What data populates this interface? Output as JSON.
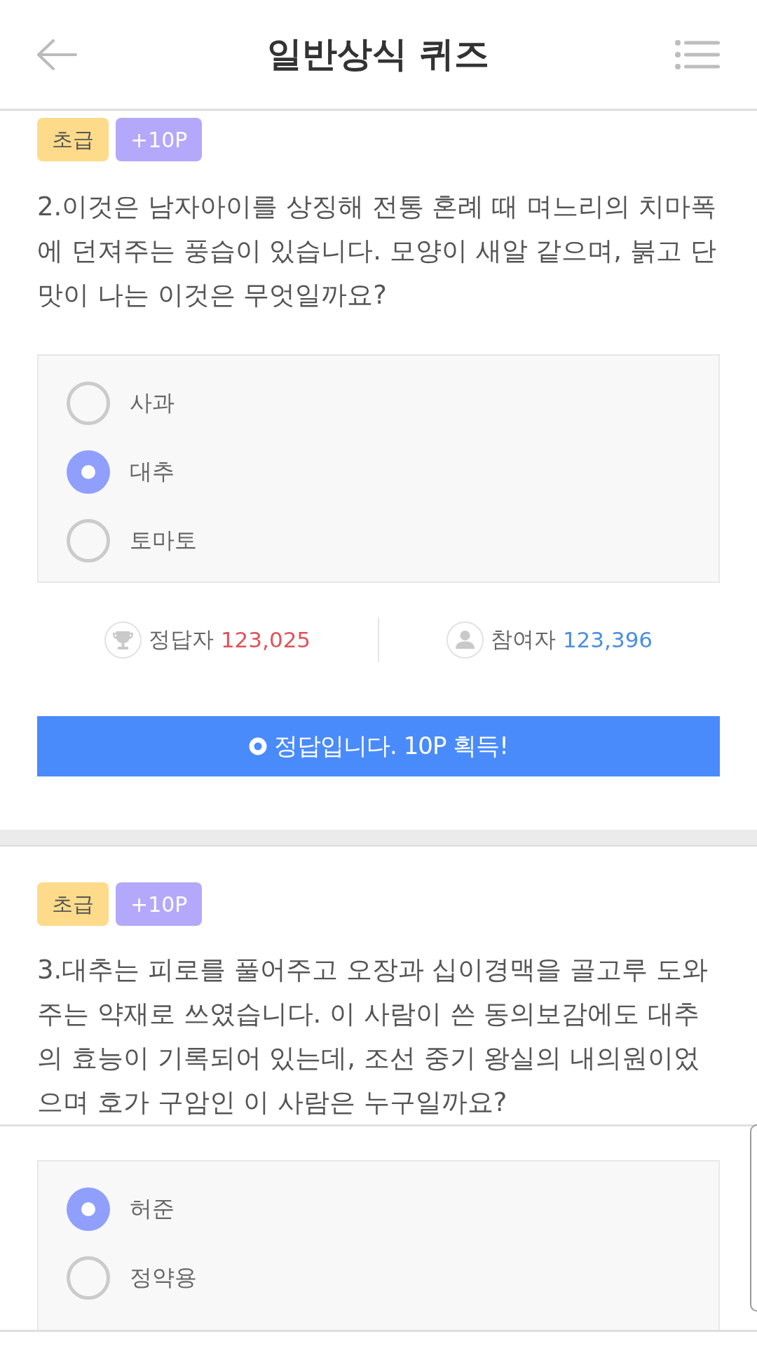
{
  "header": {
    "title": "일반상식 퀴즈"
  },
  "quizzes": [
    {
      "level": "초급",
      "points": "+10P",
      "question": "2.이것은 남자아이를 상징해 전통 혼례 때 며느리의 치마폭에 던져주는 풍습이 있습니다. 모양이 새알 같으며, 붉고 단맛이 나는 이것은 무엇일까요?",
      "options": [
        {
          "label": "사과",
          "selected": false
        },
        {
          "label": "대추",
          "selected": true
        },
        {
          "label": "토마토",
          "selected": false
        }
      ],
      "stats": [
        {
          "kind": "correct",
          "label": "정답자",
          "count": "123,025",
          "color": "#e0525b"
        },
        {
          "kind": "participants",
          "label": "참여자",
          "count": "123,396",
          "color": "#4a8ee0"
        }
      ],
      "result": "정답입니다. 10P 획득!"
    },
    {
      "level": "초급",
      "points": "+10P",
      "question": "3.대추는 피로를 풀어주고 오장과 십이경맥을 골고루 도와주는 약재로 쓰였습니다. 이 사람이 쓴 동의보감에도 대추의 효능이 기록되어 있는데, 조선 중기 왕실의 내의원이었으며 호가 구암인 이 사람은 누구일까요?",
      "options": [
        {
          "label": "허준",
          "selected": true
        },
        {
          "label": "정약용",
          "selected": false
        }
      ]
    }
  ]
}
